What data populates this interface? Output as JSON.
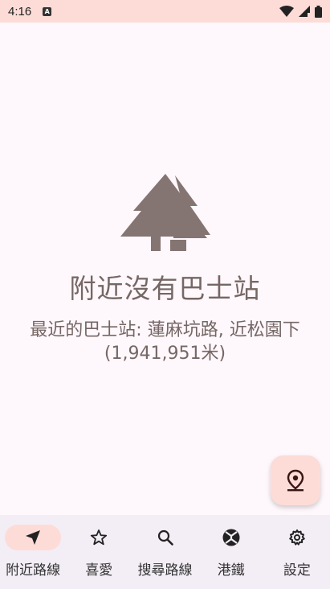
{
  "status_bar": {
    "time": "4:16",
    "app_icon": "A",
    "icons": [
      "wifi-icon",
      "signal-icon",
      "battery-icon"
    ]
  },
  "empty_state": {
    "icon": "forest-icon",
    "title": "附近沒有巴士站",
    "detail": "最近的巴士站: 蓮麻坑路, 近松園下 (1,941,951米)"
  },
  "fab": {
    "icon": "location-pin-icon"
  },
  "bottom_nav": {
    "items": [
      {
        "label": "附近路線",
        "icon": "navigation-arrow-icon",
        "active": true
      },
      {
        "label": "喜愛",
        "icon": "star-icon",
        "active": false
      },
      {
        "label": "搜尋路線",
        "icon": "search-icon",
        "active": false
      },
      {
        "label": "港鐵",
        "icon": "mtr-icon",
        "active": false
      },
      {
        "label": "設定",
        "icon": "gear-icon",
        "active": false
      }
    ]
  },
  "colors": {
    "accent": "#fddcd8",
    "text_muted": "#756765",
    "background": "#fef7fb",
    "nav_background": "#f3edf5"
  }
}
